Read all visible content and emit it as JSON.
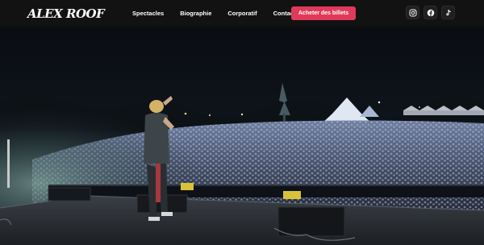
{
  "brand": {
    "name": "ALEX ROOF"
  },
  "nav": {
    "items": [
      {
        "label": "Spectacles"
      },
      {
        "label": "Biographie"
      },
      {
        "label": "Corporatif"
      },
      {
        "label": "Contact"
      }
    ],
    "cta_label": "Acheter des billets"
  },
  "social": [
    {
      "icon": "instagram-icon"
    },
    {
      "icon": "facebook-icon"
    },
    {
      "icon": "tiktok-icon"
    }
  ],
  "colors": {
    "nav_background": "#121212",
    "cta": "#e03a5a",
    "text": "#ffffff"
  }
}
